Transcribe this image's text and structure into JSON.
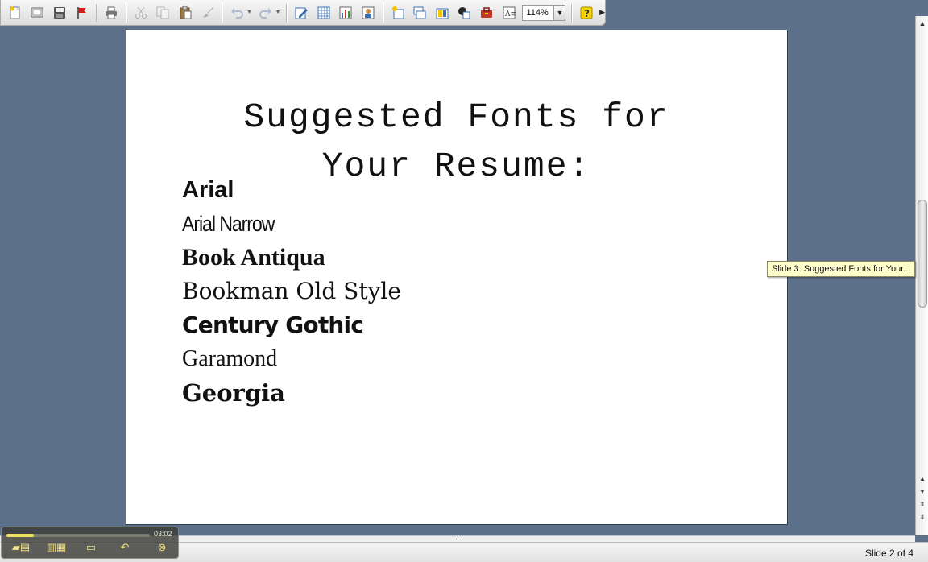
{
  "toolbar": {
    "zoom": "114%",
    "buttons": [
      "new-icon",
      "open-icon",
      "save-icon",
      "flag-icon",
      "print-icon",
      "cut-icon",
      "copy-icon",
      "paste-icon",
      "brush-icon",
      "undo-icon",
      "redo-icon",
      "edit-icon",
      "table-icon",
      "chart-icon",
      "photo-icon",
      "new-slide-icon",
      "slides-icon",
      "layout-icon",
      "transition-icon",
      "toolbox-icon",
      "textbox-icon",
      "help-icon"
    ]
  },
  "slide": {
    "title": "Suggested Fonts for\nYour Resume:",
    "fonts": [
      "Arial",
      "Arial Narrow",
      "Book Antiqua",
      "Bookman Old Style",
      "Century Gothic",
      "Garamond",
      "Georgia"
    ]
  },
  "tooltip": "Slide 3: Suggested Fonts for Your...",
  "status": {
    "slide_indicator": "Slide 2 of 4"
  },
  "recorder": {
    "time": "03:02",
    "progress": 0.19
  },
  "colors": {
    "workspace": "#5d7089",
    "tooltip_bg": "#ffffcc",
    "accent_yellow": "#f0e060"
  }
}
